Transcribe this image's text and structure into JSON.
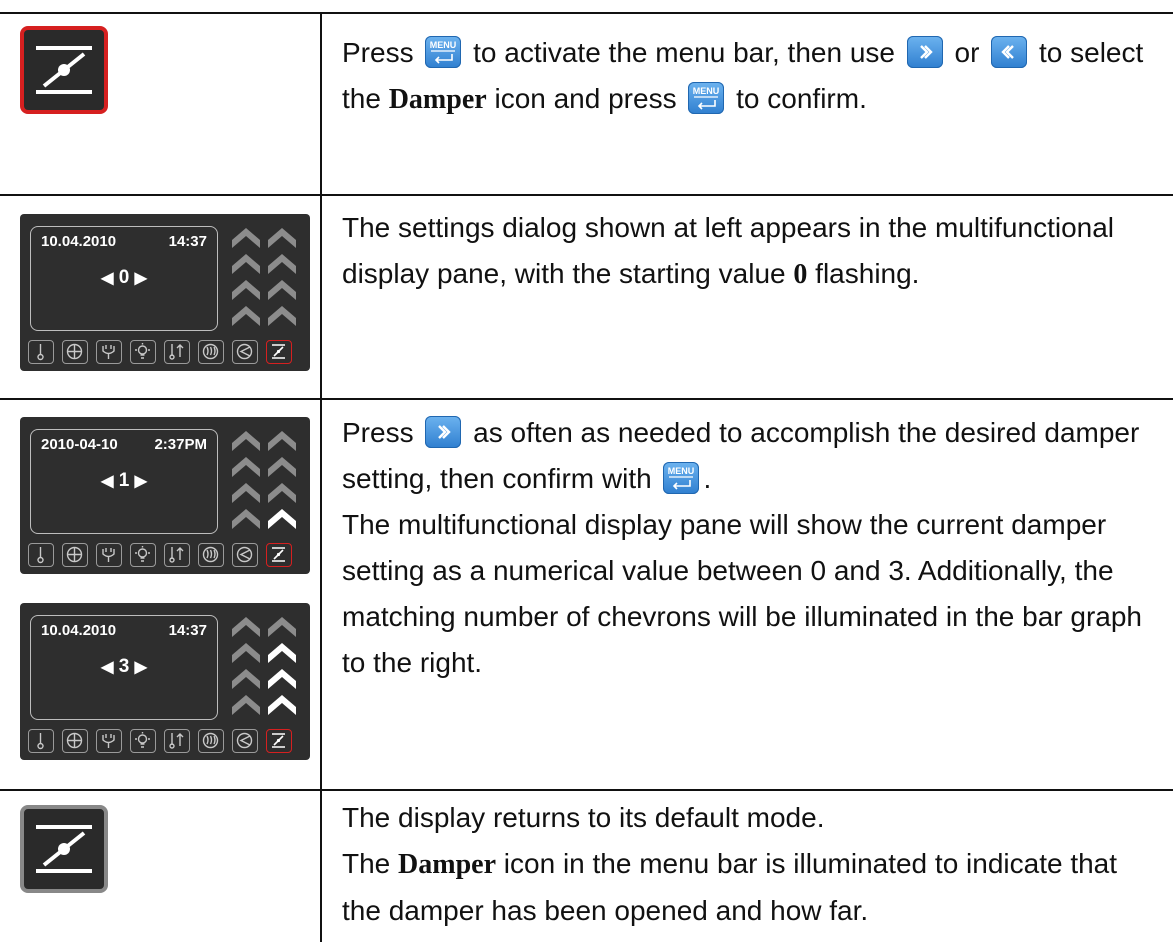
{
  "rows": [
    {
      "id": "row1",
      "paragraphs": [
        {
          "parts": [
            "Press ",
            "{menu}",
            " to activate the menu bar, then use ",
            "{next}",
            " or ",
            "{prev}",
            " to select the ",
            "**Damper",
            " icon and press ",
            "{menu}",
            " to confirm."
          ]
        }
      ]
    },
    {
      "id": "row2",
      "paragraphs": [
        {
          "parts": [
            "The settings dialog shown at left appears in the multifunctional display pane, with the starting value ",
            "**0",
            " flashing."
          ]
        }
      ]
    },
    {
      "id": "row3",
      "paragraphs": [
        {
          "parts": [
            "Press ",
            "{next}",
            " as often as needed to accomplish the desired damper setting, then confirm with ",
            "{menu}",
            "."
          ]
        },
        {
          "parts": [
            "The multifunctional display pane will show the current damper setting as a numerical value between 0 and 3. Additionally, the matching number of chevrons will be illuminated in the bar graph to the right."
          ]
        }
      ]
    },
    {
      "id": "row4",
      "paragraphs": [
        {
          "parts": [
            "The display returns to its default mode."
          ]
        },
        {
          "parts": [
            "The ",
            "**Damper",
            " icon in the menu bar is illuminated to indicate that the damper has been opened and how far."
          ]
        }
      ]
    }
  ],
  "key_menu_label": "MENU",
  "displays": [
    {
      "date": "10.04.2010",
      "time": "14:37",
      "value": "0",
      "lit_chevrons": 0
    },
    {
      "date": "2010-04-10",
      "time": "2:37PM",
      "value": "1",
      "lit_chevrons": 1
    },
    {
      "date": "10.04.2010",
      "time": "14:37",
      "value": "3",
      "lit_chevrons": 3
    }
  ],
  "menu_bar_icons": [
    "thermometer-icon",
    "fan-icon",
    "plug-icon",
    "lamp-icon",
    "temp-rise-icon",
    "heat-coil-icon",
    "defrost-icon",
    "damper-icon"
  ],
  "colors": {
    "active": "#d62020",
    "key_blue": "#2f7fd0",
    "panel": "#2e2e2e"
  }
}
